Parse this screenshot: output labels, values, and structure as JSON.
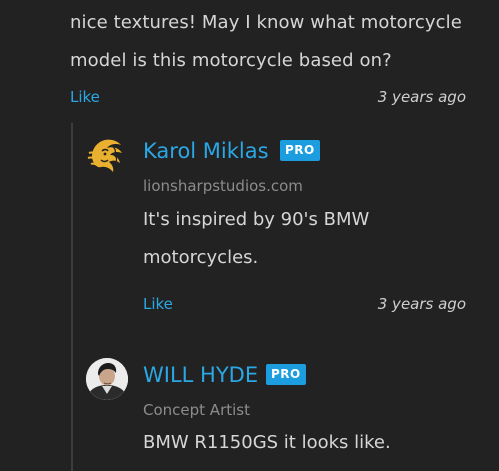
{
  "comment": {
    "text": "nice textures! May I know what motorcycle model is this motorcycle based on?",
    "like_label": "Like",
    "time": "3 years ago"
  },
  "replies": [
    {
      "author": "Karol Miklas",
      "badge": "PRO",
      "subtitle": "lionsharpstudios.com",
      "text": "It's inspired by 90's BMW motorcycles.",
      "like_label": "Like",
      "time": "3 years ago",
      "avatar_icon": "lion-head-logo-icon"
    },
    {
      "author": "WILL HYDE",
      "badge": "PRO",
      "subtitle": "Concept Artist",
      "text": "BMW R1150GS it looks like.",
      "avatar_icon": "user-photo-avatar"
    }
  ],
  "colors": {
    "background": "#222222",
    "link": "#2aa8e6",
    "badge": "#1b9ddf",
    "text": "#d6d6d6",
    "muted": "#8c8c8c"
  }
}
